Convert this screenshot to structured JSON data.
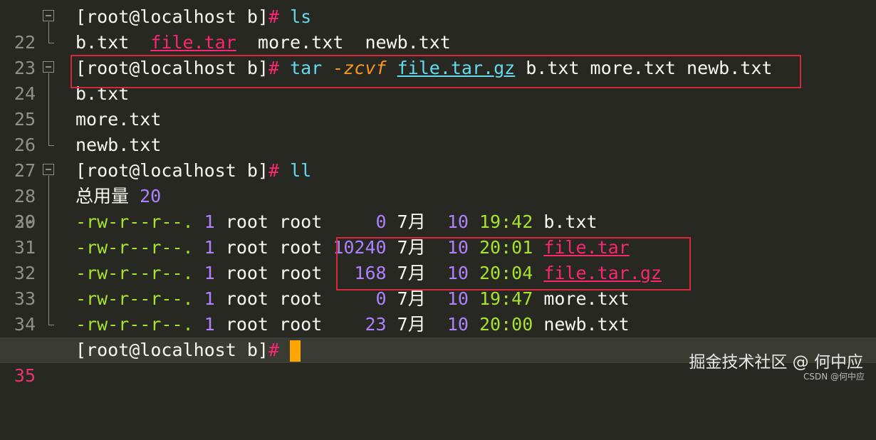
{
  "prompt": "[root@localhost b]",
  "hash": "#",
  "lines": {
    "l22": {
      "n": "22",
      "cmd": "ls"
    },
    "l23": {
      "n": "23",
      "a": "b.txt",
      "b": "file.tar",
      "c": "more.txt",
      "d": "newb.txt"
    },
    "l24": {
      "n": "24",
      "cmd": "tar",
      "opt": "-zcvf",
      "archive": "file.tar.gz",
      "args": "b.txt more.txt newb.txt"
    },
    "l25": {
      "n": "25",
      "text": "b.txt"
    },
    "l26": {
      "n": "26",
      "text": "more.txt"
    },
    "l27": {
      "n": "27",
      "text": "newb.txt"
    },
    "l28": {
      "n": "28",
      "cmd": "ll"
    },
    "l29": {
      "n": "29",
      "label": "总用量",
      "value": "20"
    },
    "l35": {
      "n": "35"
    }
  },
  "listing": [
    {
      "n": "30",
      "perm": "-rw-r--r--.",
      "links": "1",
      "owner": "root",
      "group": "root",
      "size": "0",
      "month": "7月",
      "day": "10",
      "time": "19:42",
      "name": "b.txt",
      "archive": false
    },
    {
      "n": "31",
      "perm": "-rw-r--r--.",
      "links": "1",
      "owner": "root",
      "group": "root",
      "size": "10240",
      "month": "7月",
      "day": "10",
      "time": "20:01",
      "name": "file.tar",
      "archive": true
    },
    {
      "n": "32",
      "perm": "-rw-r--r--.",
      "links": "1",
      "owner": "root",
      "group": "root",
      "size": "168",
      "month": "7月",
      "day": "10",
      "time": "20:04",
      "name": "file.tar.gz",
      "archive": true
    },
    {
      "n": "33",
      "perm": "-rw-r--r--.",
      "links": "1",
      "owner": "root",
      "group": "root",
      "size": "0",
      "month": "7月",
      "day": "10",
      "time": "19:47",
      "name": "more.txt",
      "archive": false
    },
    {
      "n": "34",
      "perm": "-rw-r--r--.",
      "links": "1",
      "owner": "root",
      "group": "root",
      "size": "23",
      "month": "7月",
      "day": "10",
      "time": "20:00",
      "name": "newb.txt",
      "archive": false
    }
  ],
  "watermark": {
    "main": "掘金技术社区 @ 何中应",
    "sub": "CSDN @何中应"
  },
  "colors": {
    "background": "#272822",
    "highlight_box": "#d7273a",
    "cursor": "#ffa500"
  }
}
